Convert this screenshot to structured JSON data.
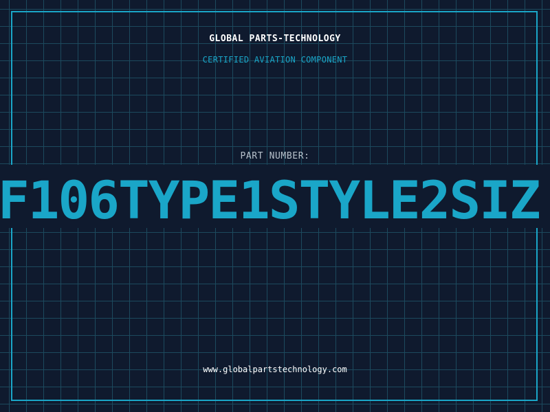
{
  "header": {
    "company": "GLOBAL PARTS-TECHNOLOGY",
    "subtitle": "CERTIFIED AVIATION COMPONENT"
  },
  "part": {
    "label": "PART NUMBER:",
    "number": "F106TYPE1STYLE2SIZ"
  },
  "footer": {
    "url": "www.globalpartstechnology.com"
  },
  "colors": {
    "background": "#0f1a2e",
    "grid": "#1c4a5e",
    "accent": "#1aa6c8",
    "text": "#ffffff"
  }
}
